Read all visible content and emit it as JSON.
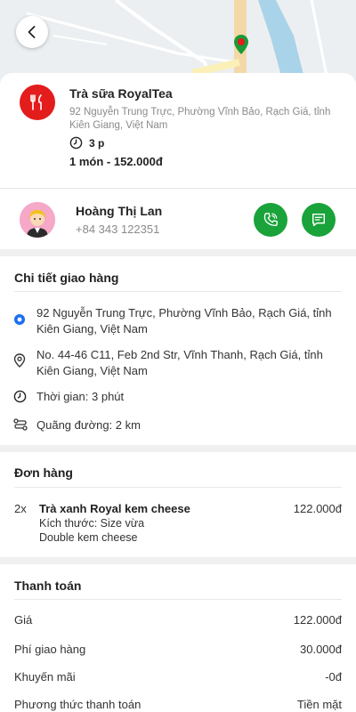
{
  "store": {
    "name": "Trà sữa RoyalTea",
    "address": "92 Nguyễn Trung Trực, Phường Vĩnh Bảo, Rạch Giá, tỉnh Kiên Giang, Việt Nam",
    "time": "3 p",
    "summary": "1 món - 152.000đ"
  },
  "driver": {
    "name": "Hoàng Thị Lan",
    "phone": "+84 343 122351"
  },
  "delivery": {
    "title": "Chi tiết giao hàng",
    "pickup": "92 Nguyễn Trung Trực, Phường Vĩnh Bảo, Rạch Giá, tỉnh Kiên Giang, Việt Nam",
    "dropoff": "No. 44-46 C11, Feb 2nd Str, Vĩnh Thanh, Rạch Giá, tỉnh Kiên Giang, Việt Nam",
    "time": "Thời gian: 3 phút",
    "distance": "Quãng đường: 2 km"
  },
  "order": {
    "title": "Đơn hàng",
    "item": {
      "qty": "2x",
      "name": "Trà xanh Royal kem cheese",
      "size": "Kích thước: Size vừa",
      "extra": "Double kem cheese",
      "price": "122.000đ"
    }
  },
  "payment": {
    "title": "Thanh toán",
    "rows": [
      {
        "label": "Giá",
        "value": "122.000đ"
      },
      {
        "label": "Phí giao hàng",
        "value": "30.000đ"
      },
      {
        "label": "Khuyến mãi",
        "value": "-0đ"
      },
      {
        "label": "Phương thức thanh toán",
        "value": "Tiền mặt"
      }
    ]
  },
  "colors": {
    "accent_green": "#19a33a",
    "store_red": "#e31c1c",
    "pickup_blue": "#1e6ff0"
  },
  "icons": [
    "back-icon",
    "fork-knife-icon",
    "clock-icon",
    "phone-icon",
    "chat-icon",
    "pickup-dot-icon",
    "location-pin-icon",
    "route-icon",
    "map-marker-icon"
  ]
}
